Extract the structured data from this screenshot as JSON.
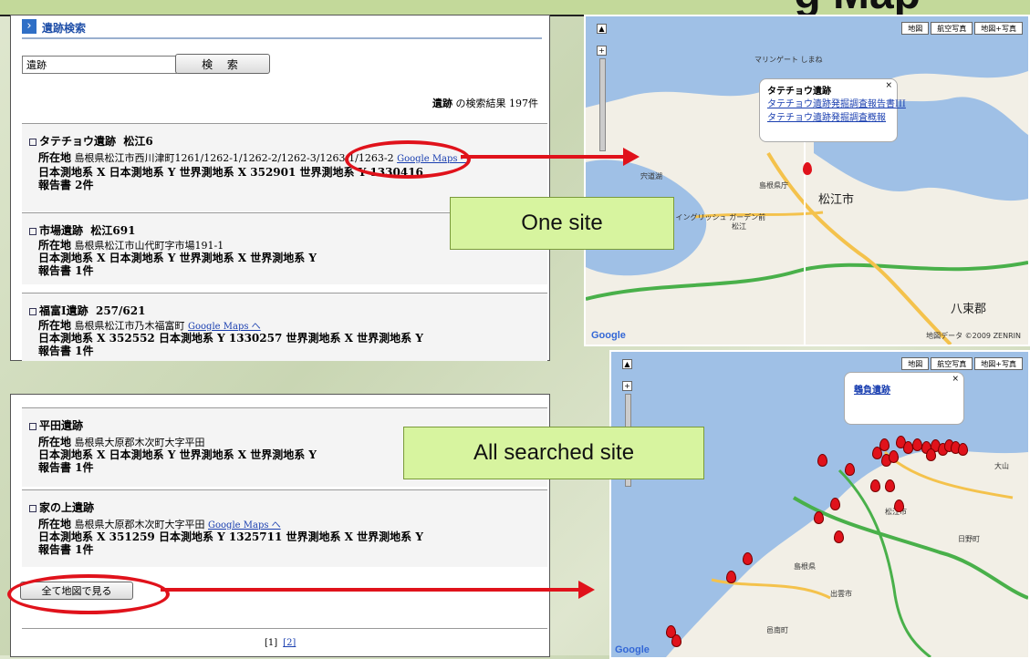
{
  "banner": {
    "title_fragment": "g Map"
  },
  "search_header": {
    "title": "遺跡検索"
  },
  "search": {
    "value": "遺跡",
    "button_label": "検 索"
  },
  "result_count": {
    "query": "遺跡",
    "suffix": " の検索結果 197件"
  },
  "entries_top": [
    {
      "title": "タテチョウ遺跡",
      "code": "松江6",
      "location_label": "所在地",
      "location": "島根県松江市西川津町1261/1262-1/1262-2/1262-3/1263-1/1263-2",
      "maps_link": "Google Maps へ",
      "coords": "日本測地系 X 日本測地系 Y 世界測地系 X 352901 世界測地系 Y 1330416",
      "report": "報告書 2件"
    },
    {
      "title": "市場遺跡",
      "code": "松江691",
      "location_label": "所在地",
      "location": "島根県松江市山代町字市場191-1",
      "maps_link": "",
      "coords": "日本測地系 X 日本測地系 Y 世界測地系 X 世界測地系 Y",
      "report": "報告書 1件"
    },
    {
      "title": "福富Ⅰ遺跡",
      "code": "257/621",
      "location_label": "所在地",
      "location": "島根県松江市乃木福富町",
      "maps_link": "Google Maps へ",
      "coords": "日本測地系 X 352552 日本測地系 Y 1330257 世界測地系 X 世界測地系 Y",
      "report": "報告書 1件"
    }
  ],
  "entries_bottom": [
    {
      "title": "平田遺跡",
      "code": "",
      "location_label": "所在地",
      "location": "島根県大原郡木次町大字平田",
      "maps_link": "",
      "coords": "日本測地系 X 日本測地系 Y 世界測地系 X 世界測地系 Y",
      "report": "報告書 1件"
    },
    {
      "title": "家の上遺跡",
      "code": "",
      "location_label": "所在地",
      "location": "島根県大原郡木次町大字平田",
      "maps_link": "Google Maps へ",
      "coords": "日本測地系 X 351259 日本測地系 Y 1325711 世界測地系 X 世界測地系 Y",
      "report": "報告書 1件"
    }
  ],
  "all_button_label": "全て地図で見る",
  "pager": {
    "current": "[1]",
    "next": "[2]"
  },
  "map_top": {
    "type_buttons": [
      "地図",
      "航空写真",
      "地図+写真"
    ],
    "info_title": "タテチョウ遺跡",
    "info_links": [
      "タテチョウ遺跡発掘調査報告書III",
      "タテチョウ遺跡発掘調査概報"
    ],
    "city_label": "松江市",
    "place_labels": [
      "マリンゲート しまね",
      "松江 イングリッシュ ガーデン前",
      "島根県庁",
      "八束郡",
      "松江",
      "宍道湖"
    ],
    "footer": "地図データ ©2009 ZENRIN"
  },
  "map_bottom": {
    "type_buttons": [
      "地図",
      "航空写真",
      "地図+写真"
    ],
    "info_title": "鵯負遺跡",
    "place_labels": [
      "出雲市",
      "松江市",
      "日野町",
      "大山",
      "島根県",
      "邑南町"
    ]
  },
  "labels": {
    "one_site": "One site",
    "all_searched": "All searched site"
  },
  "colors": {
    "annotation_red": "#e0121b",
    "label_green": "#d7f49f",
    "link_blue": "#1a3fb0",
    "water": "#9fc0e6",
    "land": "#f2efe6"
  }
}
